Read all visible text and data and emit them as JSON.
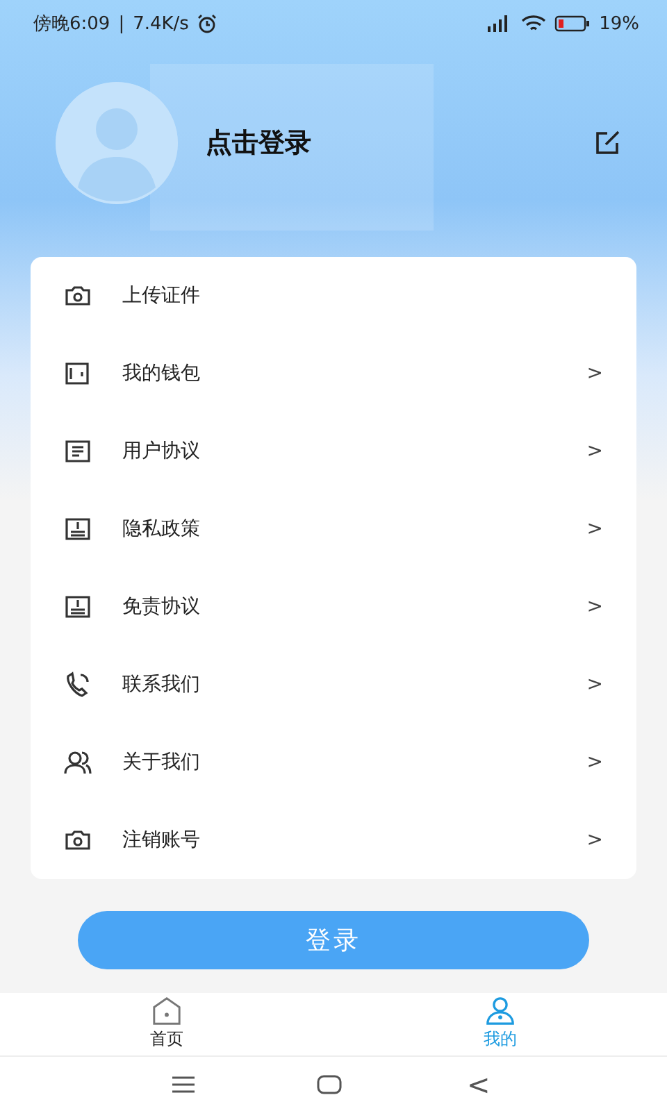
{
  "status_bar": {
    "time": "傍晚6:09",
    "separator": "|",
    "speed": "7.4K/s",
    "battery": "19%"
  },
  "profile": {
    "name": "点击登录"
  },
  "menu": [
    {
      "kind": "camera",
      "label": "上传证件"
    },
    {
      "kind": "wallet",
      "label": "我的钱包",
      "arrow": ">"
    },
    {
      "kind": "document",
      "label": "用户协议",
      "arrow": ">"
    },
    {
      "kind": "notice",
      "label": "隐私政策",
      "arrow": ">"
    },
    {
      "kind": "notice",
      "label": "免责协议",
      "arrow": ">"
    },
    {
      "kind": "phone",
      "label": "联系我们",
      "arrow": ">"
    },
    {
      "kind": "people",
      "label": "关于我们",
      "arrow": ">"
    },
    {
      "kind": "camera",
      "label": "注销账号",
      "arrow": ">"
    }
  ],
  "login_button": "登录",
  "tabs": [
    {
      "kind": "home",
      "label": "首页",
      "selected": false
    },
    {
      "kind": "user",
      "label": "我的",
      "selected": true
    }
  ],
  "nav_back": "<"
}
